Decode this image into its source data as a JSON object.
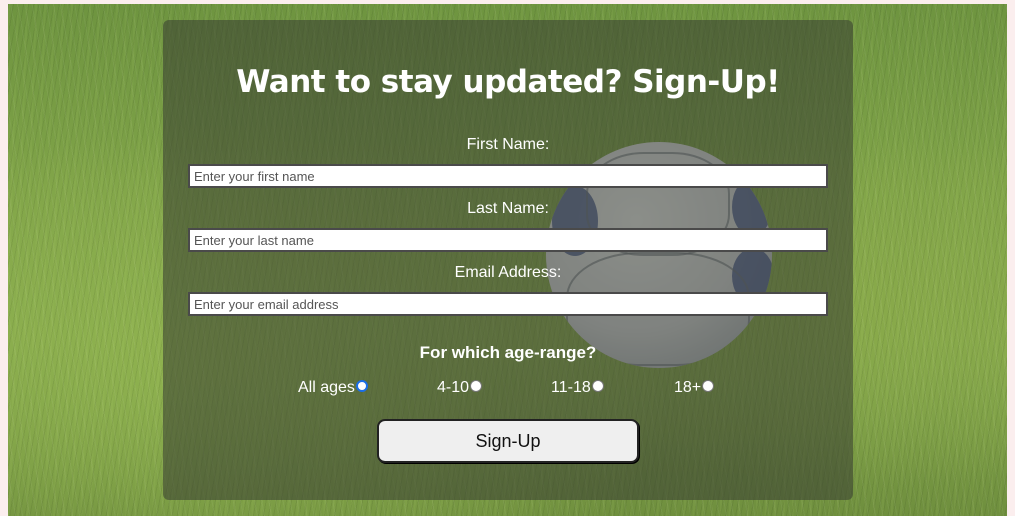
{
  "form": {
    "title": "Want to stay updated? Sign-Up!",
    "first_name": {
      "label": "First Name:",
      "placeholder": "Enter your first name"
    },
    "last_name": {
      "label": "Last Name:",
      "placeholder": "Enter your last name"
    },
    "email": {
      "label": "Email Address:",
      "placeholder": "Enter your email address"
    },
    "age_heading": "For which age-range?",
    "age_options": [
      {
        "label": "All ages",
        "checked": true
      },
      {
        "label": "4-10",
        "checked": false
      },
      {
        "label": "11-18",
        "checked": false
      },
      {
        "label": "18+",
        "checked": false
      }
    ],
    "submit_label": "Sign-Up"
  },
  "colors": {
    "overlay": "#373c32",
    "radio_accent": "#1a6ee8"
  },
  "background": {
    "icon": "soccer-ball-on-grass"
  }
}
